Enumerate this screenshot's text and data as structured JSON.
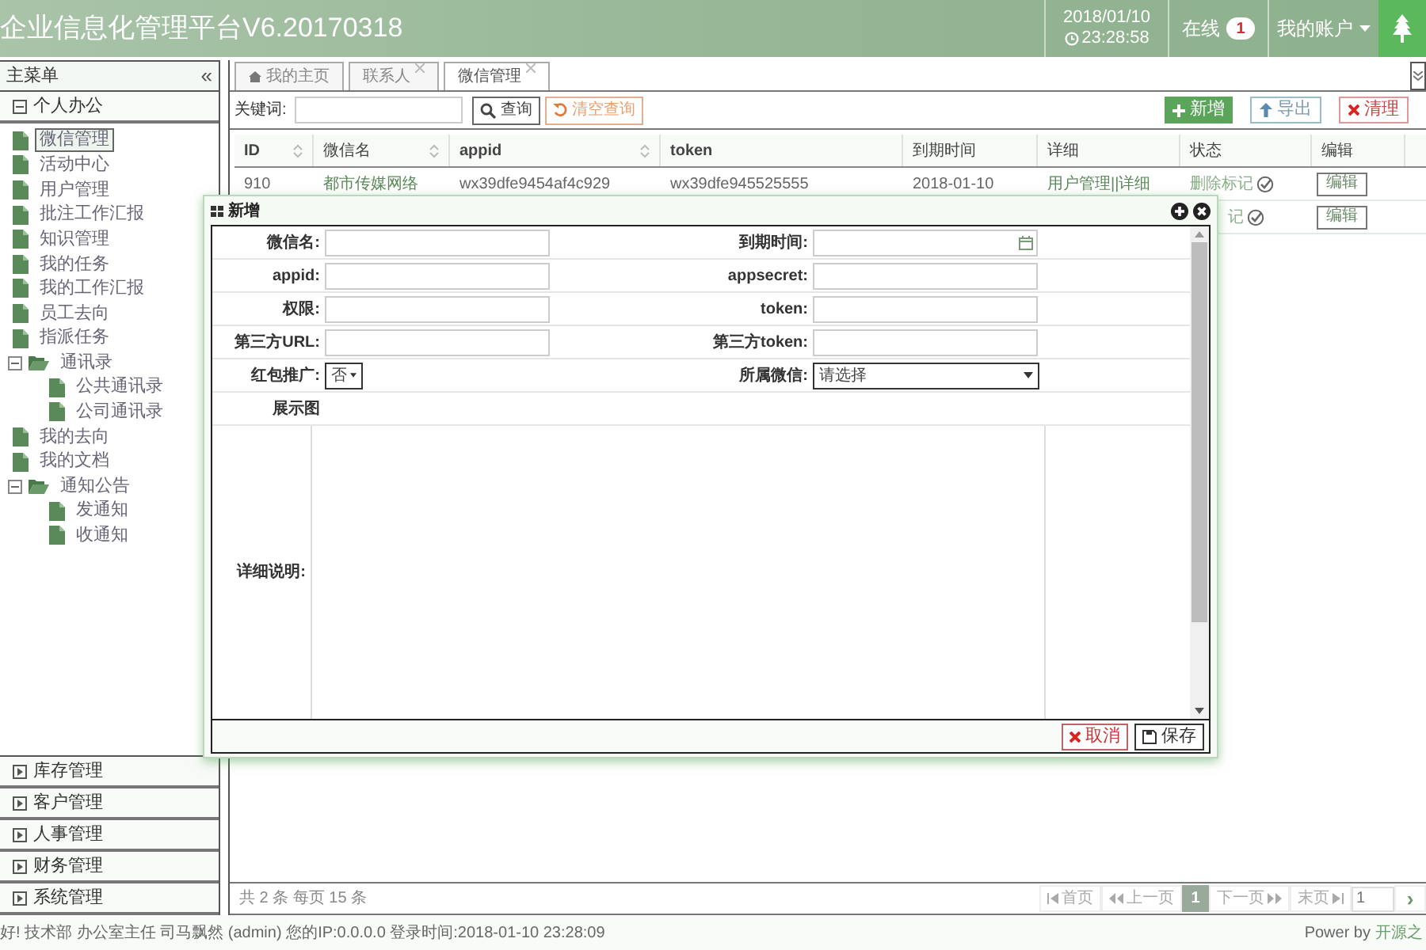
{
  "header": {
    "title": "企业信息化管理平台V6.20170318",
    "date": "2018/01/10",
    "time": "23:28:58",
    "online_label": "在线",
    "online_count": "1",
    "account": "我的账户"
  },
  "sidebar": {
    "title": "主菜单",
    "collapse": "«",
    "sections": [
      {
        "title": "个人办公",
        "expanded": true,
        "items": [
          {
            "label": "微信管理",
            "selected": true
          },
          {
            "label": "活动中心",
            "selected": false
          },
          {
            "label": "用户管理",
            "selected": false
          },
          {
            "label": "批注工作汇报",
            "selected": false
          },
          {
            "label": "知识管理",
            "selected": false
          },
          {
            "label": "我的任务",
            "selected": false
          },
          {
            "label": "我的工作汇报",
            "selected": false
          },
          {
            "label": "员工去向",
            "selected": false
          },
          {
            "label": "指派任务",
            "selected": false
          },
          {
            "label": "通讯录",
            "selected": false,
            "expanded": true,
            "children": [
              {
                "label": "公共通讯录",
                "selected": false
              },
              {
                "label": "公司通讯录",
                "selected": false
              }
            ]
          },
          {
            "label": "我的去向",
            "selected": false
          },
          {
            "label": "我的文档",
            "selected": false
          },
          {
            "label": "通知公告",
            "selected": false,
            "expanded": true,
            "children": [
              {
                "label": "发通知",
                "selected": false
              },
              {
                "label": "收通知",
                "selected": false
              }
            ]
          }
        ]
      },
      {
        "title": "库存管理",
        "expanded": false
      },
      {
        "title": "客户管理",
        "expanded": false
      },
      {
        "title": "人事管理",
        "expanded": false
      },
      {
        "title": "财务管理",
        "expanded": false
      },
      {
        "title": "系统管理",
        "expanded": false
      }
    ]
  },
  "tabs": [
    {
      "label": "我的主页",
      "home": true,
      "closable": false,
      "selected": false
    },
    {
      "label": "联系人",
      "home": false,
      "closable": true,
      "selected": false
    },
    {
      "label": "微信管理",
      "home": false,
      "closable": true,
      "selected": true
    }
  ],
  "toolbar": {
    "keyword_label": "关键词:",
    "search": "查询",
    "clear": "清空查询",
    "add": "新增",
    "export": "导出",
    "purge": "清理"
  },
  "table": {
    "columns": [
      {
        "label": "ID",
        "sortable": true
      },
      {
        "label": "微信名",
        "sortable": true
      },
      {
        "label": "appid",
        "sortable": true
      },
      {
        "label": "token",
        "sortable": false
      },
      {
        "label": "到期时间",
        "sortable": false
      },
      {
        "label": "详细",
        "sortable": false
      },
      {
        "label": "状态",
        "sortable": false
      },
      {
        "label": "编辑",
        "sortable": false
      }
    ],
    "rows": [
      {
        "cells": [
          "910",
          "都市传媒网络",
          "wx39dfe9454af4c929",
          "wx39dfe945525555",
          "2018-01-10",
          "用户管理||详细"
        ],
        "status": "删除标记",
        "edit": "编辑"
      },
      {
        "cells": [],
        "status": "记",
        "edit": "编辑"
      }
    ]
  },
  "dialog": {
    "title": "新增",
    "rows": [
      [
        {
          "label": "微信名:",
          "kind": "text"
        },
        {
          "label": "到期时间:",
          "kind": "date"
        }
      ],
      [
        {
          "label": "appid:",
          "kind": "text"
        },
        {
          "label": "appsecret:",
          "kind": "text"
        }
      ],
      [
        {
          "label": "权限:",
          "kind": "text"
        },
        {
          "label": "token:",
          "kind": "text"
        }
      ],
      [
        {
          "label": "第三方URL:",
          "kind": "text"
        },
        {
          "label": "第三方token:",
          "kind": "text"
        }
      ],
      [
        {
          "label": "红包推广:",
          "kind": "select",
          "value": "否"
        },
        {
          "label": "所属微信:",
          "kind": "select",
          "value": "请选择"
        }
      ],
      [
        {
          "label": "展示图",
          "kind": "none"
        }
      ]
    ],
    "description_label": "详细说明:",
    "cancel": "取消",
    "save": "保存"
  },
  "pagination": {
    "summary": "共 2 条 每页 15 条",
    "first": "首页",
    "prev": "上一页",
    "pages": [
      {
        "label": "1",
        "selected": true
      }
    ],
    "next": "下一页",
    "last": "末页",
    "page_input": "1",
    "go": "›"
  },
  "status_bar": {
    "text": "好! 技术部 办公室主任 司马飘然 (admin) 您的IP:0.0.0.0 登录时间:2018-01-10 23:28:09",
    "power": "Power by",
    "power_link": "开源之"
  }
}
